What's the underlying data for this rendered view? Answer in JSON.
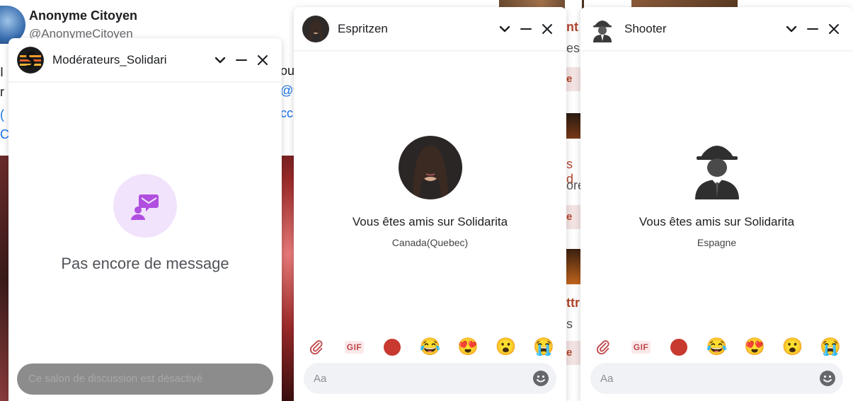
{
  "background": {
    "profile_name": "Anonyme Citoyen",
    "profile_handle": "@AnonymeCitoyen",
    "left_fragments": [
      "I",
      "r",
      "(",
      "C"
    ],
    "mid_fragments": [
      "ou",
      "@v",
      "cc"
    ],
    "right_fragments": [
      "nt",
      "es",
      "e",
      "s d",
      "ore",
      "e",
      "ttr",
      "s",
      "e"
    ]
  },
  "chats": [
    {
      "id": "mod",
      "title": "Modérateurs_Solidari",
      "empty_text": "Pas encore de message",
      "disabled_placeholder": "Ce salon de discussion est désactivé"
    },
    {
      "id": "esp",
      "title": "Espritzen",
      "friend_text": "Vous êtes amis sur Solidarita",
      "location": "Canada(Quebec)",
      "gif_label": "GIF",
      "emojis": [
        "😂",
        "😍",
        "😮",
        "😭"
      ],
      "input_placeholder": "Aa"
    },
    {
      "id": "sho",
      "title": "Shooter",
      "friend_text": "Vous êtes amis sur Solidarita",
      "location": "Espagne",
      "gif_label": "GIF",
      "emojis": [
        "😂",
        "😍",
        "😮",
        "😭"
      ],
      "input_placeholder": "Aa"
    }
  ],
  "colors": {
    "accent_purple": "#b04fe0",
    "empty_bubble": "#f1e3fb",
    "record_red": "#c8392f",
    "gif_red": "#c0474b"
  }
}
